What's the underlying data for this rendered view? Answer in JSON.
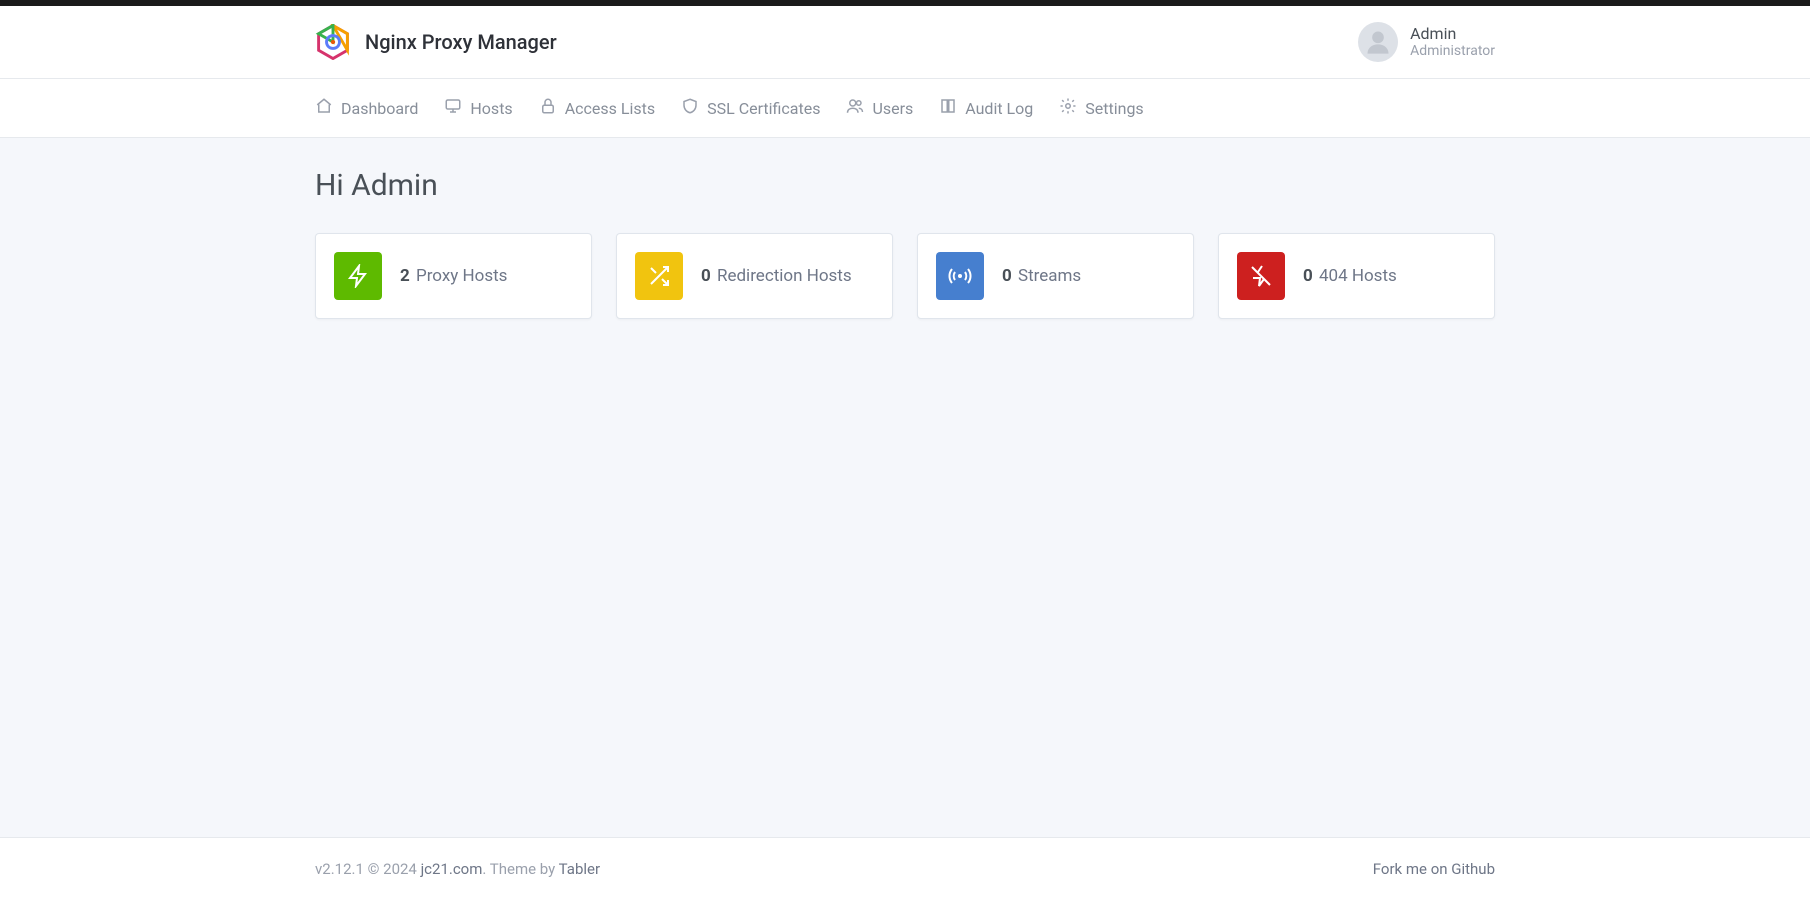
{
  "header": {
    "title": "Nginx Proxy Manager",
    "user_name": "Admin",
    "user_role": "Administrator"
  },
  "nav": {
    "items": [
      {
        "label": "Dashboard"
      },
      {
        "label": "Hosts"
      },
      {
        "label": "Access Lists"
      },
      {
        "label": "SSL Certificates"
      },
      {
        "label": "Users"
      },
      {
        "label": "Audit Log"
      },
      {
        "label": "Settings"
      }
    ]
  },
  "main": {
    "greeting": "Hi Admin",
    "cards": [
      {
        "count": "2",
        "label": "Proxy Hosts"
      },
      {
        "count": "0",
        "label": "Redirection Hosts"
      },
      {
        "count": "0",
        "label": "Streams"
      },
      {
        "count": "0",
        "label": "404 Hosts"
      }
    ]
  },
  "footer": {
    "version": "v2.12.1",
    "copyright_prefix": " © 2024 ",
    "company": "jc21.com",
    "theme_prefix": ". Theme by ",
    "theme_name": "Tabler",
    "fork_link": "Fork me on Github"
  }
}
